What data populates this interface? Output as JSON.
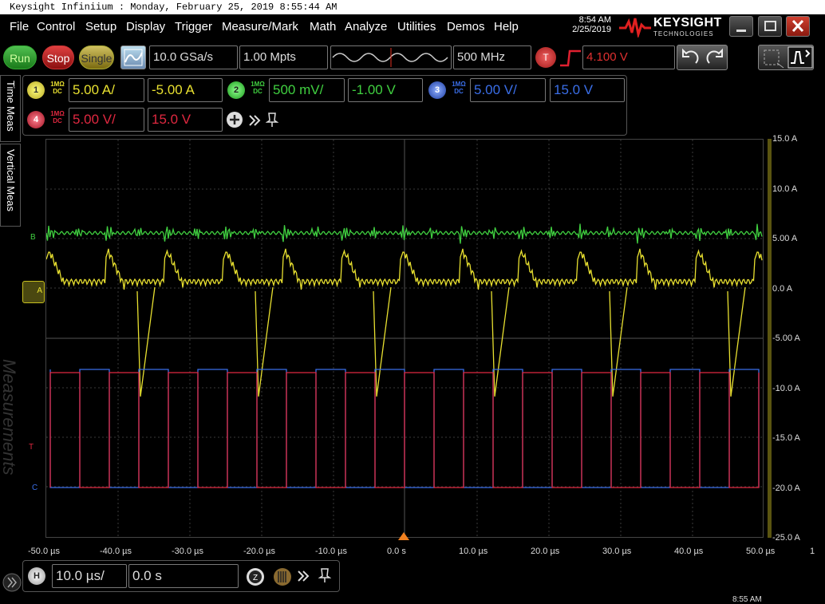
{
  "window": {
    "title": "Keysight Infiniium : Monday, February 25, 2019 8:55:44 AM"
  },
  "menu": [
    "File",
    "Control",
    "Setup",
    "Display",
    "Trigger",
    "Measure/Mark",
    "Math",
    "Analyze",
    "Utilities",
    "Demos",
    "Help"
  ],
  "clock": {
    "time": "8:54 AM",
    "date": "2/25/2019",
    "bottom_time": "8:55 AM"
  },
  "brand": {
    "name": "KEYSIGHT",
    "sub": "TECHNOLOGIES"
  },
  "toolbar": {
    "run": "Run",
    "stop": "Stop",
    "single": "Single",
    "sample_rate": "10.0 GSa/s",
    "memory": "1.00 Mpts",
    "bandwidth": "500 MHz",
    "trigger_badge": "T",
    "trigger_level": "4.100 V"
  },
  "channels": [
    {
      "num": "1",
      "coupling_top": "1MΩ",
      "coupling_bot": "DC",
      "scale": "5.00 A/",
      "offset": "-5.00 A",
      "color": "#e8e030"
    },
    {
      "num": "2",
      "coupling_top": "1MΩ",
      "coupling_bot": "DC",
      "scale": "500 mV/",
      "offset": "-1.00 V",
      "color": "#40d040"
    },
    {
      "num": "3",
      "coupling_top": "1MΩ",
      "coupling_bot": "DC",
      "scale": "5.00 V/",
      "offset": "15.0 V",
      "color": "#3a6ee8"
    },
    {
      "num": "4",
      "coupling_top": "1MΩ",
      "coupling_bot": "DC",
      "scale": "5.00 V/",
      "offset": "15.0 V",
      "color": "#e02840"
    }
  ],
  "side_tabs": {
    "time_meas": "Time Meas",
    "vertical_meas": "Vertical Meas",
    "measurements": "Measurements"
  },
  "markers": {
    "b": "B",
    "a": "A",
    "t": "T",
    "c": "C"
  },
  "right_axis": [
    "15.0 A",
    "10.0 A",
    "5.00 A",
    "0.0 A",
    "-5.00 A",
    "-10.0 A",
    "-15.0 A",
    "-20.0 A",
    "-25.0 A"
  ],
  "time_axis": [
    "-50.0 µs",
    "-40.0 µs",
    "-30.0 µs",
    "-20.0 µs",
    "-10.0 µs",
    "0.0 s",
    "10.0 µs",
    "20.0 µs",
    "30.0 µs",
    "40.0 µs",
    "50.0 µs"
  ],
  "page_indicator": "1",
  "horizontal": {
    "badge": "H",
    "scale": "10.0 µs/",
    "position": "0.0 s"
  }
}
